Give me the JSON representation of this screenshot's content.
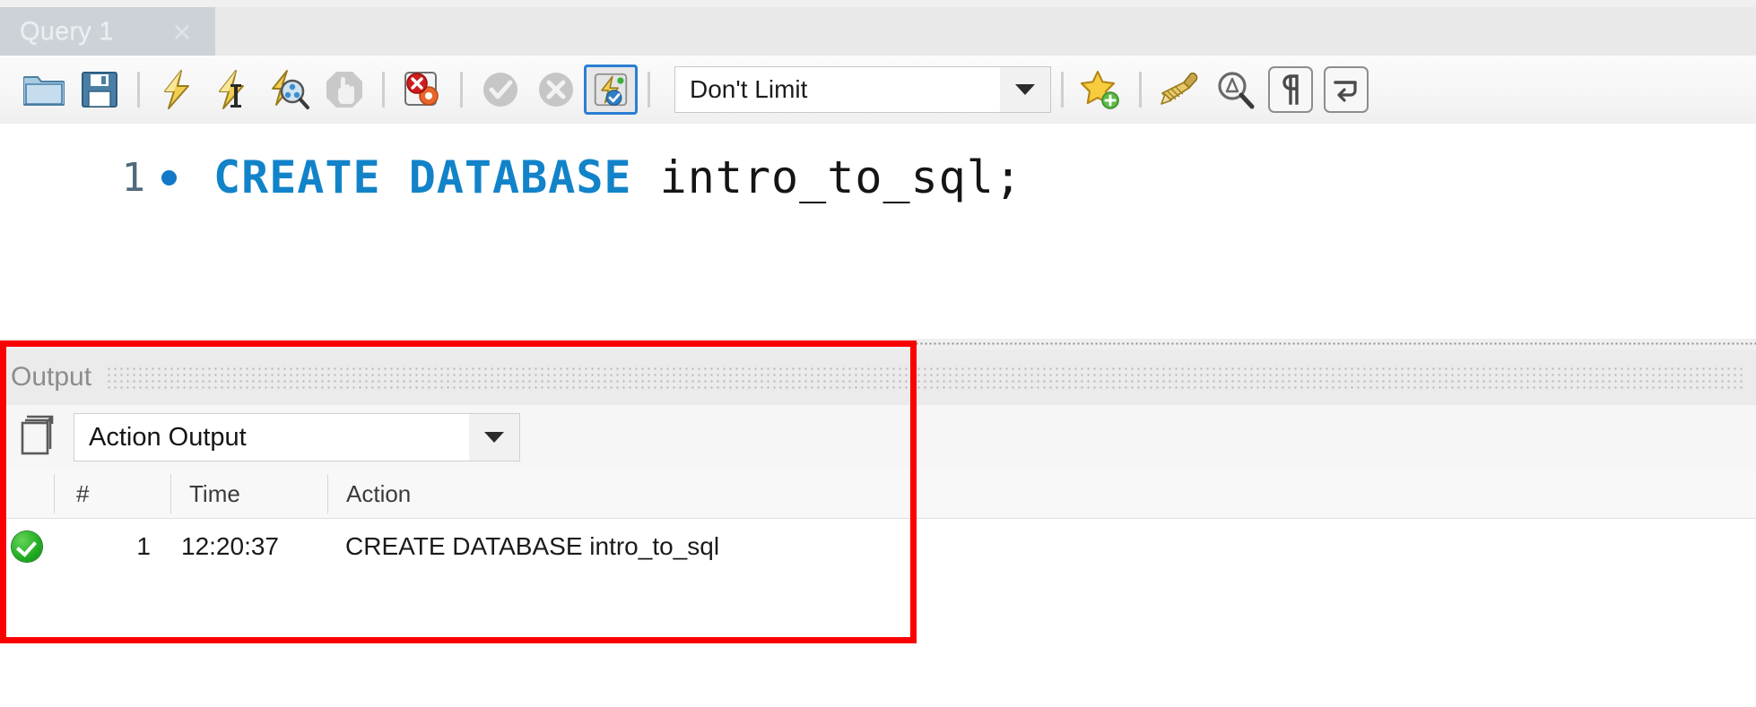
{
  "tab": {
    "label": "Query 1",
    "close_icon": "close-icon"
  },
  "toolbar": {
    "buttons": [
      {
        "name": "open-sql-script-button",
        "icon": "folder-icon",
        "title": "Open a SQL script file"
      },
      {
        "name": "save-script-button",
        "icon": "floppy-disk-save-icon",
        "title": "Save script to file"
      },
      {
        "name": "execute-statement-button",
        "icon": "lightning-bolt-icon",
        "title": "Execute the selected portion of the script"
      },
      {
        "name": "execute-current-button",
        "icon": "lightning-bolt-cursor-icon",
        "title": "Execute the statement under the keyboard cursor"
      },
      {
        "name": "explain-statement-button",
        "icon": "lightning-magnifier-icon",
        "title": "Execute Explain for the statement under the cursor"
      },
      {
        "name": "stop-execution-button",
        "icon": "stop-hand-icon",
        "title": "Stop the query being executed"
      },
      {
        "name": "toggle-stop-on-error-button",
        "icon": "stop-on-error-icon",
        "title": "Toggle whether execution should stop on errors"
      },
      {
        "name": "commit-button",
        "icon": "commit-check-icon",
        "title": "Commit the current transaction"
      },
      {
        "name": "rollback-button",
        "icon": "rollback-cross-icon",
        "title": "Rollback the current transaction"
      },
      {
        "name": "toggle-autocommit-button",
        "icon": "autocommit-lightning-icon",
        "title": "Toggle autocommit mode"
      }
    ],
    "limit_select": {
      "value": "Don't Limit",
      "arrow_icon": "chevron-down-icon"
    },
    "right_buttons": [
      {
        "name": "save-snippet-button",
        "icon": "star-add-icon",
        "title": "Save current statement to snippets"
      },
      {
        "name": "beautify-sql-button",
        "icon": "beautify-brush-icon",
        "title": "Beautify/reformat the SQL script"
      },
      {
        "name": "find-button",
        "icon": "search-magnifier-icon",
        "title": "Show the Find panel"
      },
      {
        "name": "toggle-invisible-chars-button",
        "icon": "pilcrow-icon",
        "title": "Toggle invisible characters"
      },
      {
        "name": "toggle-word-wrap-button",
        "icon": "word-wrap-icon",
        "title": "Toggle wrapping of long lines"
      }
    ]
  },
  "editor": {
    "line_number": "1",
    "execution_marker": "execution-dot-marker",
    "statement_keyword": "CREATE DATABASE",
    "statement_identifier": " intro_to_sql;"
  },
  "output": {
    "panel_title": "Output",
    "view_select": {
      "value": "Action Output",
      "icon": "stacked-windows-icon",
      "arrow_icon": "chevron-down-icon"
    },
    "table": {
      "columns": [
        "#",
        "Time",
        "Action"
      ],
      "rows": [
        {
          "status": "success",
          "status_icon": "green-check-circle-icon",
          "num": "1",
          "time": "12:20:37",
          "action": "CREATE DATABASE intro_to_sql"
        }
      ]
    }
  },
  "annotation": {
    "name": "red-highlight-rectangle",
    "color": "#fb0000"
  },
  "colors": {
    "keyword_blue": "#1283c9",
    "tab_background": "#cdd2d8",
    "toggle_border": "#2a7fd4",
    "success_green": "#1faa21"
  }
}
